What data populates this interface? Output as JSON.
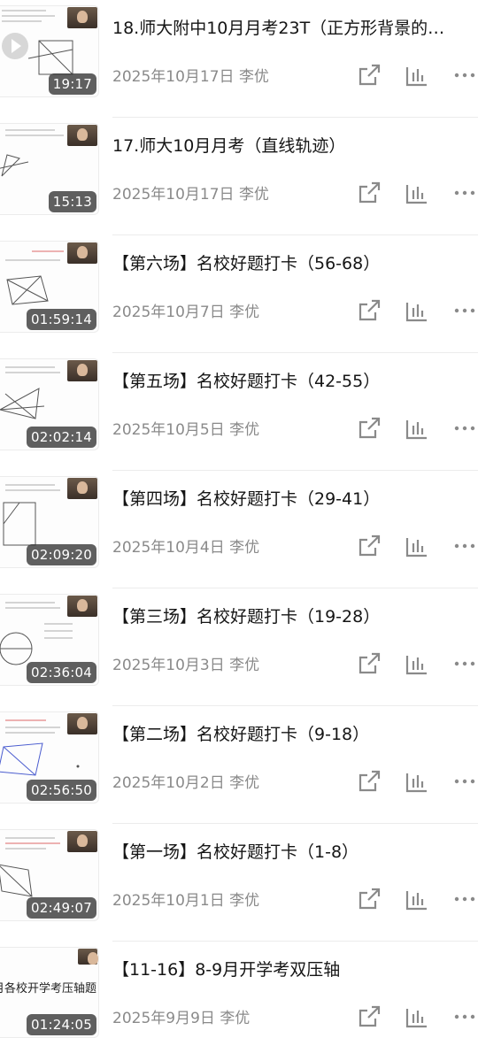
{
  "videos": [
    {
      "title": "18.师大附中10月月考23T（正方形背景的…",
      "date": "2025年10月17日",
      "author": "李优",
      "duration": "19:17"
    },
    {
      "title": "17.师大10月月考（直线轨迹）",
      "date": "2025年10月17日",
      "author": "李优",
      "duration": "15:13"
    },
    {
      "title": "【第六场】名校好题打卡（56-68）",
      "date": "2025年10月7日",
      "author": "李优",
      "duration": "01:59:14"
    },
    {
      "title": "【第五场】名校好题打卡（42-55）",
      "date": "2025年10月5日",
      "author": "李优",
      "duration": "02:02:14"
    },
    {
      "title": "【第四场】名校好题打卡（29-41）",
      "date": "2025年10月4日",
      "author": "李优",
      "duration": "02:09:20"
    },
    {
      "title": "【第三场】名校好题打卡（19-28）",
      "date": "2025年10月3日",
      "author": "李优",
      "duration": "02:36:04"
    },
    {
      "title": "【第二场】名校好题打卡（9-18）",
      "date": "2025年10月2日",
      "author": "李优",
      "duration": "02:56:50"
    },
    {
      "title": "【第一场】名校好题打卡（1-8）",
      "date": "2025年10月1日",
      "author": "李优",
      "duration": "02:49:07"
    },
    {
      "title": "【11-16】8-9月开学考双压轴",
      "date": "2025年9月9日",
      "author": "李优",
      "duration": "01:24:05",
      "thumb_text": "月各校开学考压轴题"
    }
  ],
  "icons": {
    "share": "share-icon",
    "stats": "stats-icon",
    "more": "more-icon"
  },
  "colors": {
    "meta_text": "#8a8a8a",
    "icon": "#8a8a8a",
    "duration_bg": "#3c3c3c"
  }
}
